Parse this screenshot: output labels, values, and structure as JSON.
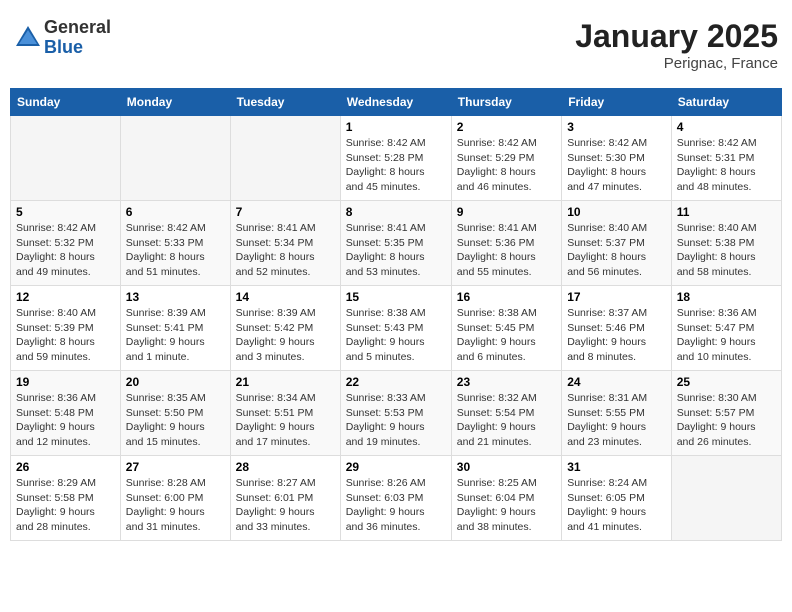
{
  "header": {
    "logo_general": "General",
    "logo_blue": "Blue",
    "month": "January 2025",
    "location": "Perignac, France"
  },
  "weekdays": [
    "Sunday",
    "Monday",
    "Tuesday",
    "Wednesday",
    "Thursday",
    "Friday",
    "Saturday"
  ],
  "weeks": [
    [
      {
        "day": "",
        "info": ""
      },
      {
        "day": "",
        "info": ""
      },
      {
        "day": "",
        "info": ""
      },
      {
        "day": "1",
        "info": "Sunrise: 8:42 AM\nSunset: 5:28 PM\nDaylight: 8 hours\nand 45 minutes."
      },
      {
        "day": "2",
        "info": "Sunrise: 8:42 AM\nSunset: 5:29 PM\nDaylight: 8 hours\nand 46 minutes."
      },
      {
        "day": "3",
        "info": "Sunrise: 8:42 AM\nSunset: 5:30 PM\nDaylight: 8 hours\nand 47 minutes."
      },
      {
        "day": "4",
        "info": "Sunrise: 8:42 AM\nSunset: 5:31 PM\nDaylight: 8 hours\nand 48 minutes."
      }
    ],
    [
      {
        "day": "5",
        "info": "Sunrise: 8:42 AM\nSunset: 5:32 PM\nDaylight: 8 hours\nand 49 minutes."
      },
      {
        "day": "6",
        "info": "Sunrise: 8:42 AM\nSunset: 5:33 PM\nDaylight: 8 hours\nand 51 minutes."
      },
      {
        "day": "7",
        "info": "Sunrise: 8:41 AM\nSunset: 5:34 PM\nDaylight: 8 hours\nand 52 minutes."
      },
      {
        "day": "8",
        "info": "Sunrise: 8:41 AM\nSunset: 5:35 PM\nDaylight: 8 hours\nand 53 minutes."
      },
      {
        "day": "9",
        "info": "Sunrise: 8:41 AM\nSunset: 5:36 PM\nDaylight: 8 hours\nand 55 minutes."
      },
      {
        "day": "10",
        "info": "Sunrise: 8:40 AM\nSunset: 5:37 PM\nDaylight: 8 hours\nand 56 minutes."
      },
      {
        "day": "11",
        "info": "Sunrise: 8:40 AM\nSunset: 5:38 PM\nDaylight: 8 hours\nand 58 minutes."
      }
    ],
    [
      {
        "day": "12",
        "info": "Sunrise: 8:40 AM\nSunset: 5:39 PM\nDaylight: 8 hours\nand 59 minutes."
      },
      {
        "day": "13",
        "info": "Sunrise: 8:39 AM\nSunset: 5:41 PM\nDaylight: 9 hours\nand 1 minute."
      },
      {
        "day": "14",
        "info": "Sunrise: 8:39 AM\nSunset: 5:42 PM\nDaylight: 9 hours\nand 3 minutes."
      },
      {
        "day": "15",
        "info": "Sunrise: 8:38 AM\nSunset: 5:43 PM\nDaylight: 9 hours\nand 5 minutes."
      },
      {
        "day": "16",
        "info": "Sunrise: 8:38 AM\nSunset: 5:45 PM\nDaylight: 9 hours\nand 6 minutes."
      },
      {
        "day": "17",
        "info": "Sunrise: 8:37 AM\nSunset: 5:46 PM\nDaylight: 9 hours\nand 8 minutes."
      },
      {
        "day": "18",
        "info": "Sunrise: 8:36 AM\nSunset: 5:47 PM\nDaylight: 9 hours\nand 10 minutes."
      }
    ],
    [
      {
        "day": "19",
        "info": "Sunrise: 8:36 AM\nSunset: 5:48 PM\nDaylight: 9 hours\nand 12 minutes."
      },
      {
        "day": "20",
        "info": "Sunrise: 8:35 AM\nSunset: 5:50 PM\nDaylight: 9 hours\nand 15 minutes."
      },
      {
        "day": "21",
        "info": "Sunrise: 8:34 AM\nSunset: 5:51 PM\nDaylight: 9 hours\nand 17 minutes."
      },
      {
        "day": "22",
        "info": "Sunrise: 8:33 AM\nSunset: 5:53 PM\nDaylight: 9 hours\nand 19 minutes."
      },
      {
        "day": "23",
        "info": "Sunrise: 8:32 AM\nSunset: 5:54 PM\nDaylight: 9 hours\nand 21 minutes."
      },
      {
        "day": "24",
        "info": "Sunrise: 8:31 AM\nSunset: 5:55 PM\nDaylight: 9 hours\nand 23 minutes."
      },
      {
        "day": "25",
        "info": "Sunrise: 8:30 AM\nSunset: 5:57 PM\nDaylight: 9 hours\nand 26 minutes."
      }
    ],
    [
      {
        "day": "26",
        "info": "Sunrise: 8:29 AM\nSunset: 5:58 PM\nDaylight: 9 hours\nand 28 minutes."
      },
      {
        "day": "27",
        "info": "Sunrise: 8:28 AM\nSunset: 6:00 PM\nDaylight: 9 hours\nand 31 minutes."
      },
      {
        "day": "28",
        "info": "Sunrise: 8:27 AM\nSunset: 6:01 PM\nDaylight: 9 hours\nand 33 minutes."
      },
      {
        "day": "29",
        "info": "Sunrise: 8:26 AM\nSunset: 6:03 PM\nDaylight: 9 hours\nand 36 minutes."
      },
      {
        "day": "30",
        "info": "Sunrise: 8:25 AM\nSunset: 6:04 PM\nDaylight: 9 hours\nand 38 minutes."
      },
      {
        "day": "31",
        "info": "Sunrise: 8:24 AM\nSunset: 6:05 PM\nDaylight: 9 hours\nand 41 minutes."
      },
      {
        "day": "",
        "info": ""
      }
    ]
  ]
}
